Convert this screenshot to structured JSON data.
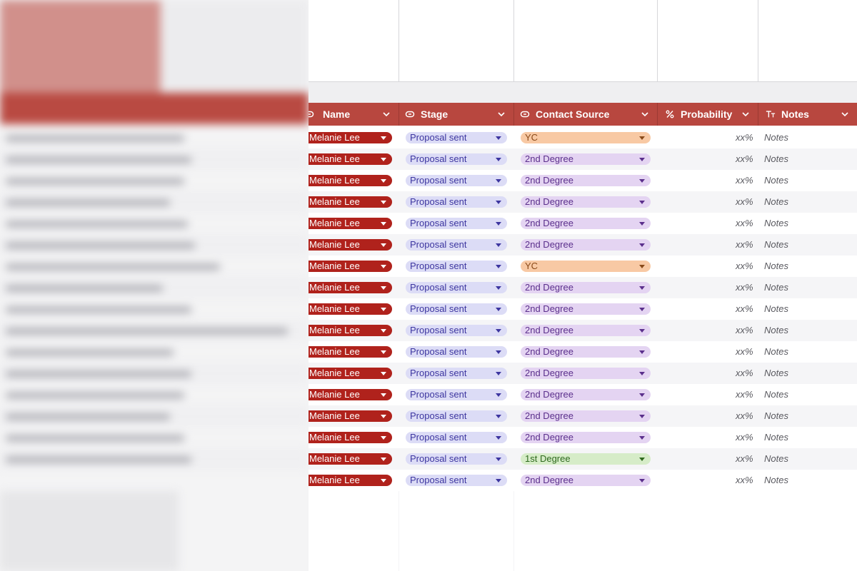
{
  "columns": [
    {
      "label": "Name",
      "icon": "link-chip-icon"
    },
    {
      "label": "Stage",
      "icon": "link-chip-icon"
    },
    {
      "label": "Contact Source",
      "icon": "link-chip-icon"
    },
    {
      "label": "Probability",
      "icon": "percent-icon"
    },
    {
      "label": "Notes",
      "icon": "text-type-icon"
    }
  ],
  "colors": {
    "header": "#b8473f",
    "name_chip": "#b0221c",
    "stage_chip": "#dcdcf6",
    "source_yc": "#f8c9a4",
    "source_2nd": "#e4d4f2",
    "source_1st": "#d6ecc8"
  },
  "rows": [
    {
      "name": "Melanie Lee",
      "stage": "Proposal sent",
      "source": "YC",
      "probability": "xx%",
      "notes": "Notes"
    },
    {
      "name": "Melanie Lee",
      "stage": "Proposal sent",
      "source": "2nd Degree",
      "probability": "xx%",
      "notes": "Notes"
    },
    {
      "name": "Melanie Lee",
      "stage": "Proposal sent",
      "source": "2nd Degree",
      "probability": "xx%",
      "notes": "Notes"
    },
    {
      "name": "Melanie Lee",
      "stage": "Proposal sent",
      "source": "2nd Degree",
      "probability": "xx%",
      "notes": "Notes"
    },
    {
      "name": "Melanie Lee",
      "stage": "Proposal sent",
      "source": "2nd Degree",
      "probability": "xx%",
      "notes": "Notes"
    },
    {
      "name": "Melanie Lee",
      "stage": "Proposal sent",
      "source": "2nd Degree",
      "probability": "xx%",
      "notes": "Notes"
    },
    {
      "name": "Melanie Lee",
      "stage": "Proposal sent",
      "source": "YC",
      "probability": "xx%",
      "notes": "Notes"
    },
    {
      "name": "Melanie Lee",
      "stage": "Proposal sent",
      "source": "2nd Degree",
      "probability": "xx%",
      "notes": "Notes"
    },
    {
      "name": "Melanie Lee",
      "stage": "Proposal sent",
      "source": "2nd Degree",
      "probability": "xx%",
      "notes": "Notes"
    },
    {
      "name": "Melanie Lee",
      "stage": "Proposal sent",
      "source": "2nd Degree",
      "probability": "xx%",
      "notes": "Notes"
    },
    {
      "name": "Melanie Lee",
      "stage": "Proposal sent",
      "source": "2nd Degree",
      "probability": "xx%",
      "notes": "Notes"
    },
    {
      "name": "Melanie Lee",
      "stage": "Proposal sent",
      "source": "2nd Degree",
      "probability": "xx%",
      "notes": "Notes"
    },
    {
      "name": "Melanie Lee",
      "stage": "Proposal sent",
      "source": "2nd Degree",
      "probability": "xx%",
      "notes": "Notes"
    },
    {
      "name": "Melanie Lee",
      "stage": "Proposal sent",
      "source": "2nd Degree",
      "probability": "xx%",
      "notes": "Notes"
    },
    {
      "name": "Melanie Lee",
      "stage": "Proposal sent",
      "source": "2nd Degree",
      "probability": "xx%",
      "notes": "Notes"
    },
    {
      "name": "Melanie Lee",
      "stage": "Proposal sent",
      "source": "1st Degree",
      "probability": "xx%",
      "notes": "Notes"
    },
    {
      "name": "Melanie Lee",
      "stage": "Proposal sent",
      "source": "2nd Degree",
      "probability": "xx%",
      "notes": "Notes"
    }
  ]
}
